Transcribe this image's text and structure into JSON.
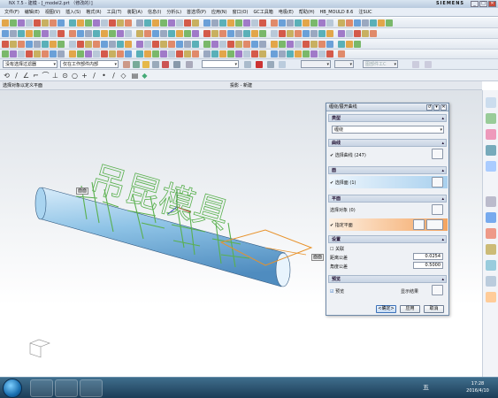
{
  "window": {
    "title": "NX 7.5 - 建模 - [_model2.prt （修改的）]",
    "brand": "SIEMENS",
    "min": "_",
    "max": "□",
    "close": "✕"
  },
  "menu": [
    "文件(F)",
    "编辑(E)",
    "视图(V)",
    "插入(S)",
    "格式(R)",
    "工具(T)",
    "装配(A)",
    "信息(I)",
    "分析(L)",
    "首选项(P)",
    "应用(N)",
    "窗口(O)",
    "GC工具箱",
    "电极(E)",
    "帮助(H)",
    "HB_MOULD 8.6",
    "注SUC"
  ],
  "filter": {
    "type_filter": "没有选择过滤器",
    "scope": "仅在工作部件内部",
    "mid_select": "",
    "disabled1": "",
    "disabled2": "",
    "disabled3": "图部件工C"
  },
  "cue": {
    "left": "选择对象以定义平面",
    "right": "投影 - 新建"
  },
  "viewport": {
    "face_label": "面面",
    "plane_label": "面面",
    "watermark": "吊昆模具"
  },
  "dialog": {
    "title": "缠绕/展开曲线",
    "type_section": "类型",
    "type_value": "缠绕",
    "curve_section": "曲线",
    "curve_select": "✔ 选择曲线 (247)",
    "face_section": "面",
    "face_select": "✔ 选择面 (1)",
    "plane_section": "平面",
    "plane_select": "选择对象 (0)",
    "plane_specify": "✔ 指定平面",
    "settings_section": "设置",
    "associative": "关联",
    "distance_tol_label": "距离公差",
    "distance_tol": "0.0254",
    "angle_tol_label": "角度公差",
    "angle_tol": "0.5000",
    "preview_section": "预览",
    "preview_check": "预览",
    "show_result": "显示结果",
    "ok": "<确定>",
    "apply": "应用",
    "cancel": "取消",
    "collapse": "▴"
  },
  "taskbar": {
    "time": "17:28",
    "date": "2016/4/10",
    "ime": "五"
  },
  "colors": {
    "accent_orange": "#f4a460",
    "highlight_blue": "#a8d0ee",
    "tube": "#8ec3e6",
    "curve_green": "#59b04e",
    "curve_orange": "#e8922a"
  }
}
